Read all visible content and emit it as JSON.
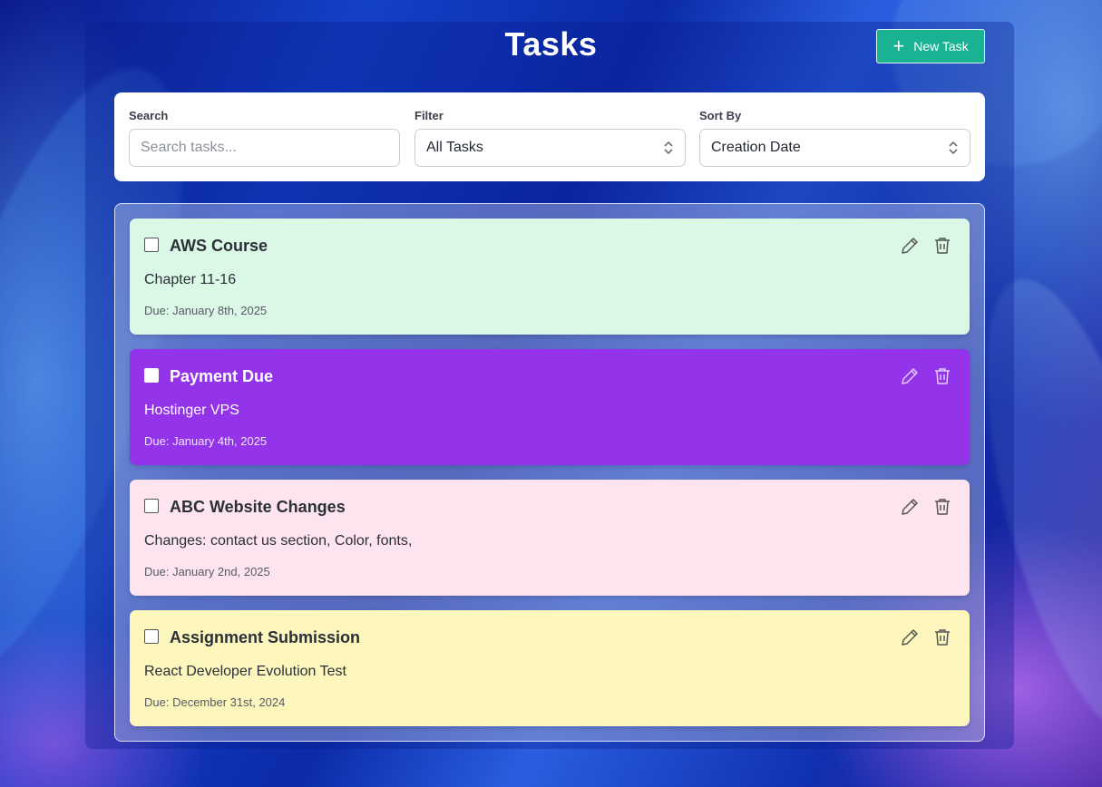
{
  "header": {
    "title": "Tasks",
    "new_task_label": "New Task"
  },
  "controls": {
    "search": {
      "label": "Search",
      "placeholder": "Search tasks...",
      "value": ""
    },
    "filter": {
      "label": "Filter",
      "value": "All Tasks"
    },
    "sort": {
      "label": "Sort By",
      "value": "Creation Date"
    }
  },
  "tasks": [
    {
      "title": "AWS Course",
      "description": "Chapter 11-16",
      "due": "Due: January 8th, 2025",
      "completed": false,
      "color": "#dbf7e6"
    },
    {
      "title": "Payment Due",
      "description": "Hostinger VPS",
      "due": "Due: January 4th, 2025",
      "completed": false,
      "color": "#9333ea"
    },
    {
      "title": "ABC Website Changes",
      "description": "Changes: contact us section, Color, fonts,",
      "due": "Due: January 2nd, 2025",
      "completed": false,
      "color": "#fde4ef"
    },
    {
      "title": "Assignment Submission",
      "description": "React Developer Evolution Test",
      "due": "Due: December 31st, 2024",
      "completed": false,
      "color": "#fdf7be"
    }
  ],
  "colors": {
    "accent": "#19b394",
    "panel_bg": "#0a1e8c"
  },
  "icons": [
    "plus-icon",
    "chevron-updown-icon",
    "pencil-icon",
    "trash-icon"
  ]
}
